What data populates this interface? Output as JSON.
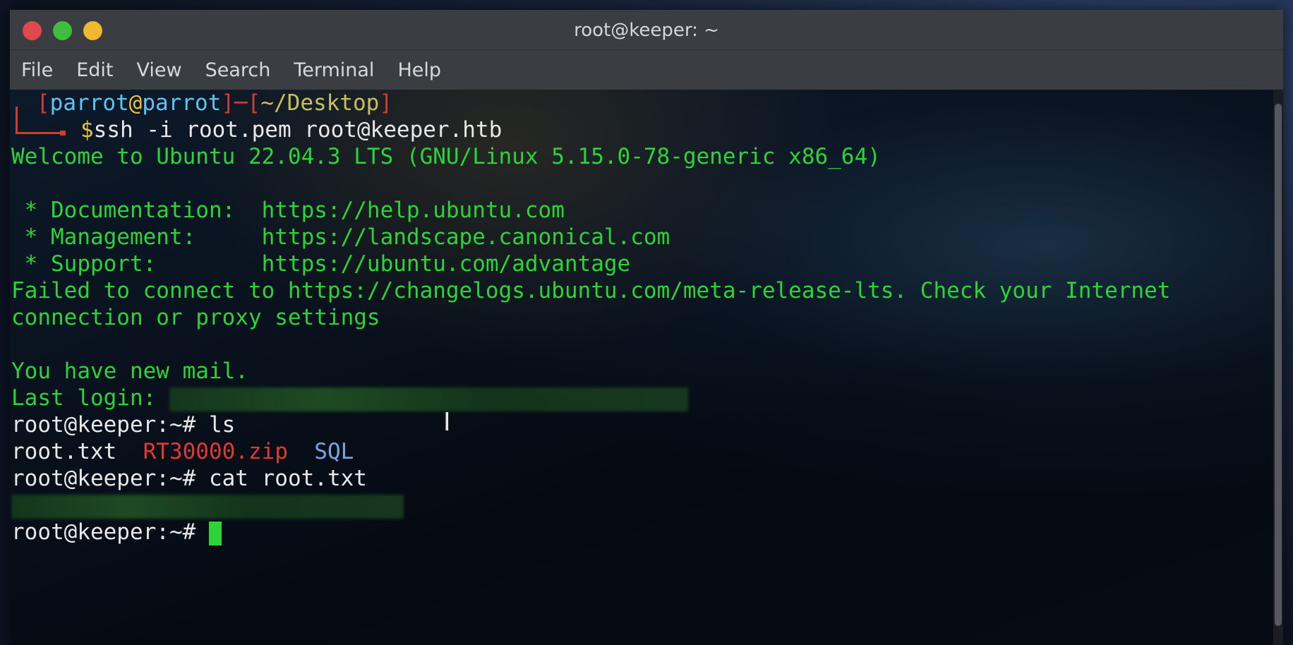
{
  "window": {
    "title": "root@keeper: ~",
    "buttons": {
      "close": "close",
      "minimize": "minimize",
      "maximize": "maximize"
    }
  },
  "menu": [
    "File",
    "Edit",
    "View",
    "Search",
    "Terminal",
    "Help"
  ],
  "terminal": {
    "prompt1": {
      "open": "[",
      "user": "parrot",
      "at": "@",
      "host": "parrot",
      "close": "]",
      "dash": "─",
      "path_open": "[",
      "path": "~/Desktop",
      "path_close": "]"
    },
    "prompt2": {
      "dollar": "$",
      "command": "ssh -i root.pem root@keeper.htb"
    },
    "welcome": "Welcome to Ubuntu 22.04.3 LTS (GNU/Linux 5.15.0-78-generic x86_64)",
    "doc_line": " * Documentation:  https://help.ubuntu.com",
    "mgmt_line": " * Management:     https://landscape.canonical.com",
    "support_line": " * Support:        https://ubuntu.com/advantage",
    "failed1": "Failed to connect to https://changelogs.ubuntu.com/meta-release-lts. Check your Internet",
    "failed2": "connection or proxy settings",
    "mail": "You have new mail.",
    "last_login_label": "Last login: ",
    "ls_prompt": "root@keeper:~# ",
    "ls_cmd": "ls",
    "files": [
      {
        "name": "root.txt",
        "color": "#e8e8e8"
      },
      {
        "name": "RT30000.zip",
        "color": "#e23a2f"
      },
      {
        "name": "SQL",
        "color": "#7aa4e0"
      }
    ],
    "cat_prompt": "root@keeper:~# ",
    "cat_cmd": "cat root.txt",
    "final_prompt": "root@keeper:~# "
  }
}
